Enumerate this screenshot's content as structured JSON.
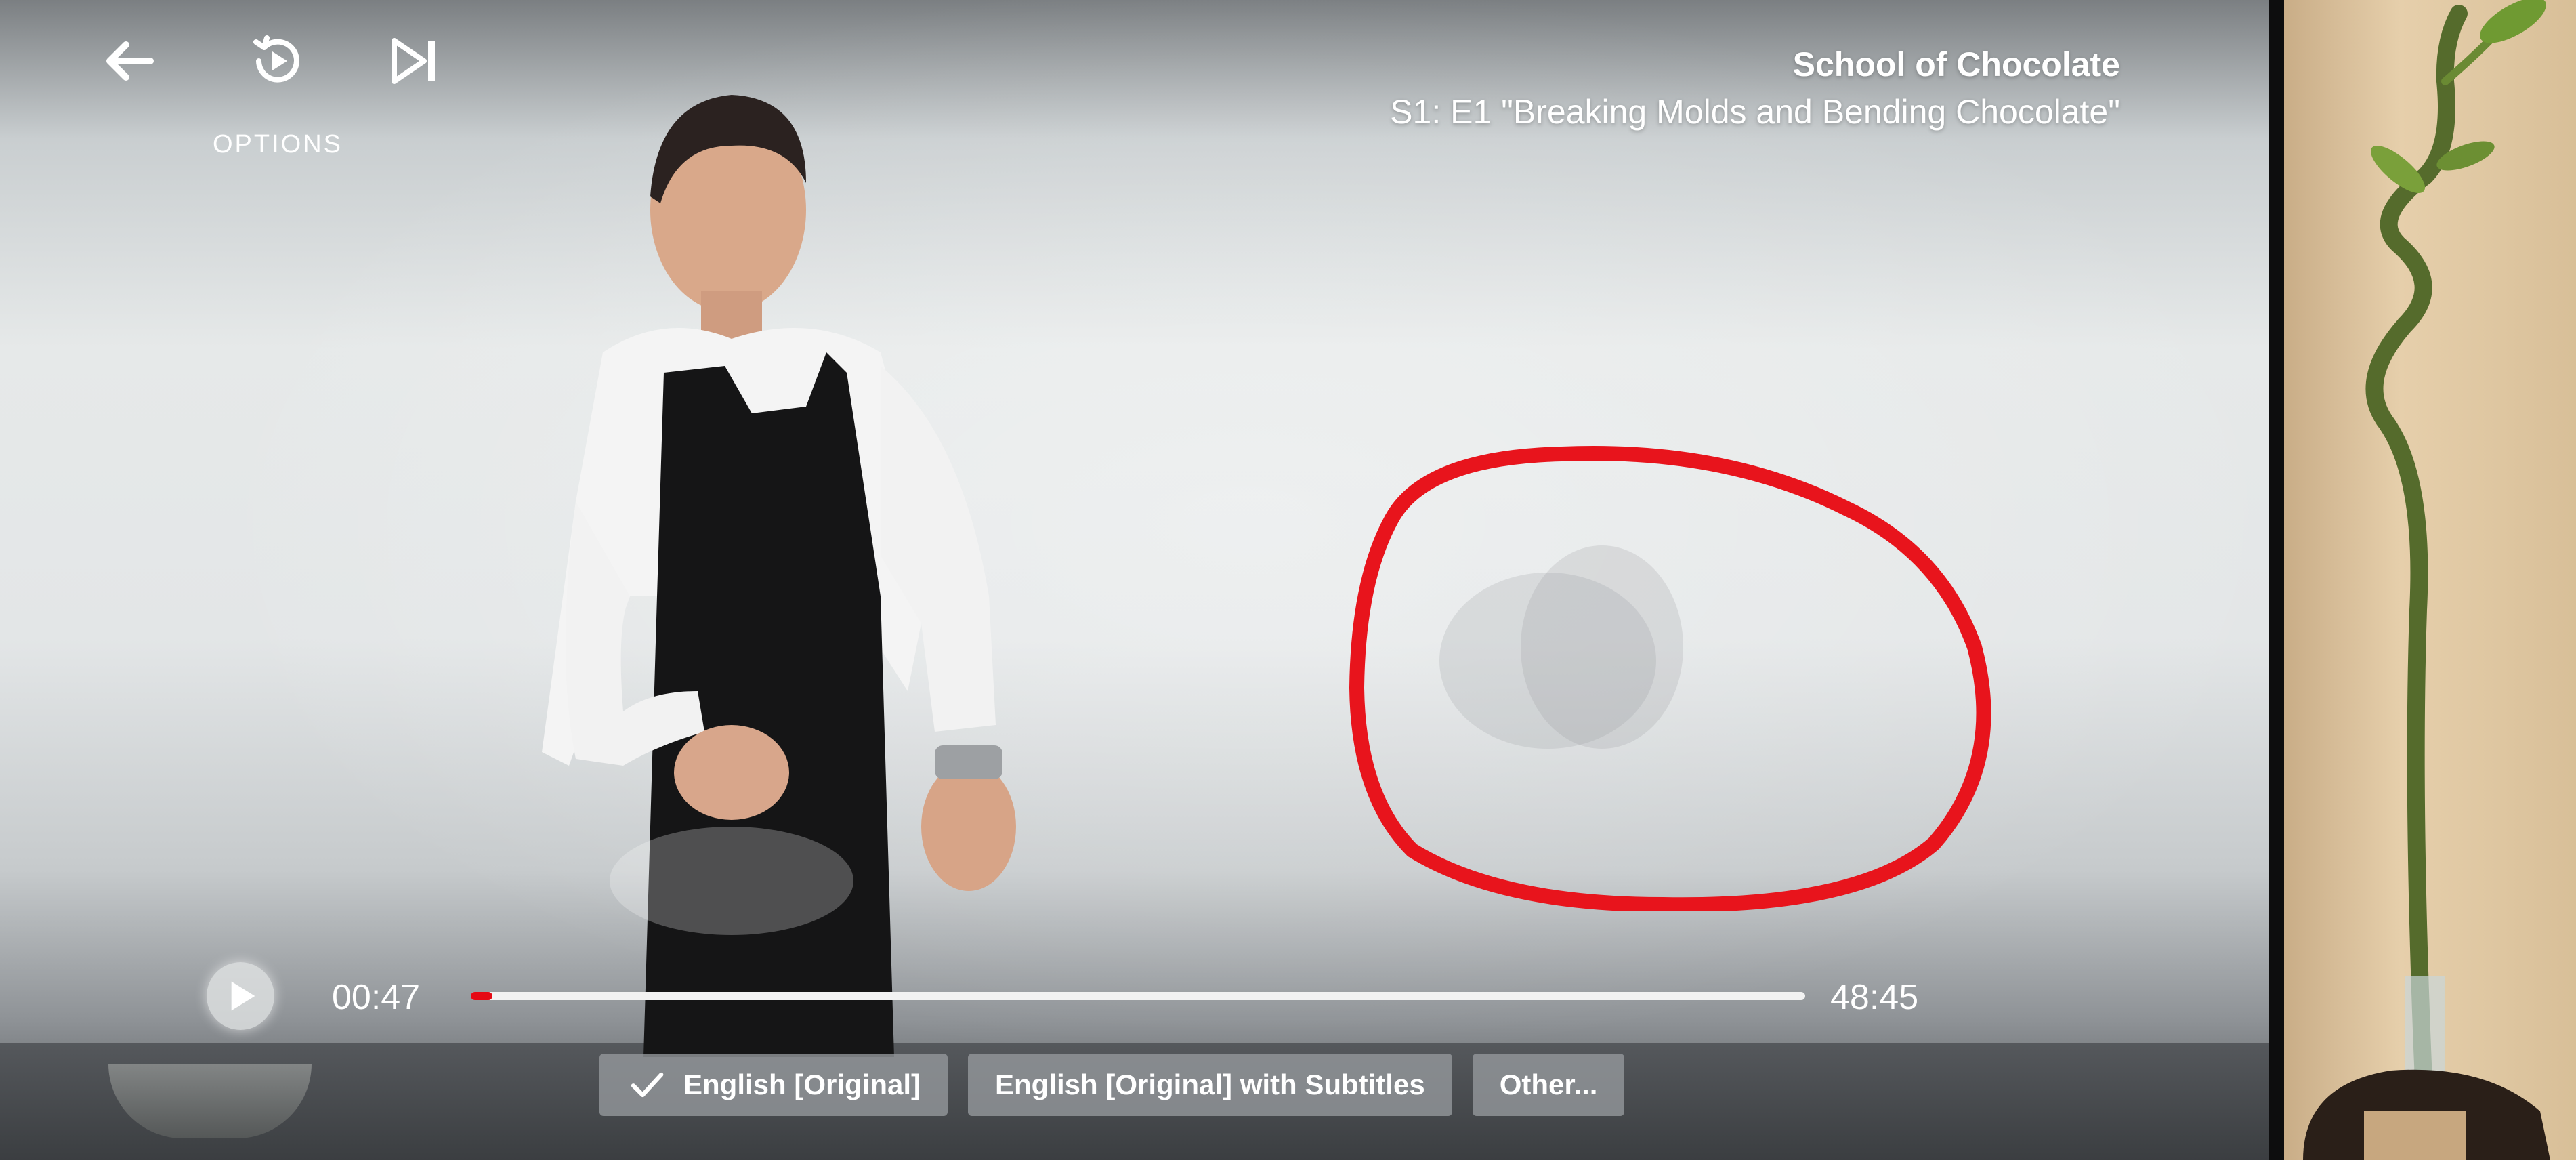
{
  "player": {
    "options_label": "OPTIONS",
    "show_title": "School of Chocolate",
    "episode_title": "S1: E1 \"Breaking Molds and Bending Chocolate\"",
    "time_current": "00:47",
    "time_total": "48:45",
    "progress_fraction": 0.016,
    "accent_color": "#e50914"
  },
  "audio_options": [
    {
      "label": "English [Original]",
      "selected": true
    },
    {
      "label": "English [Original] with Subtitles",
      "selected": false
    },
    {
      "label": "Other...",
      "selected": false
    }
  ],
  "icons": {
    "back": "arrow-left-icon",
    "options": "replay-options-icon",
    "next": "skip-next-icon",
    "play": "play-icon",
    "check": "check-icon"
  },
  "annotation_color": "#e8141c"
}
